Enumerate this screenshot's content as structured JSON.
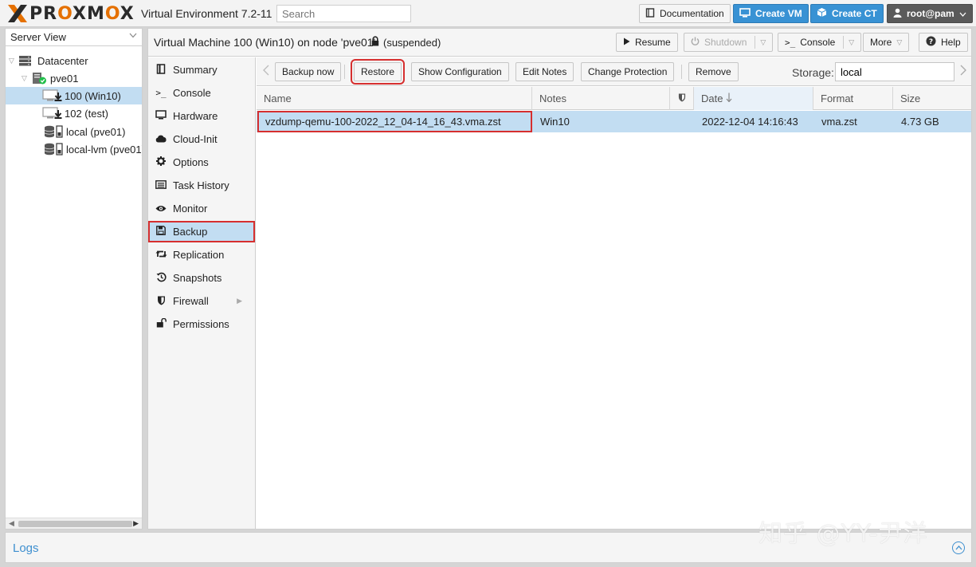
{
  "header": {
    "logo_prefix": "PR",
    "logo_o1": "O",
    "logo_mid": "XM",
    "logo_o2": "O",
    "logo_suffix": "X",
    "product": "Virtual Environment 7.2-11",
    "search_placeholder": "Search",
    "buttons": {
      "documentation": "Documentation",
      "create_vm": "Create VM",
      "create_ct": "Create CT",
      "user": "root@pam"
    }
  },
  "tree": {
    "view": "Server View",
    "items": [
      {
        "label": "Datacenter",
        "icon": "datacenter-icon"
      },
      {
        "label": "pve01",
        "icon": "node-online-icon"
      },
      {
        "label": "100 (Win10)",
        "icon": "vm-suspended-icon"
      },
      {
        "label": "102 (test)",
        "icon": "vm-suspended-icon"
      },
      {
        "label": "local (pve01)",
        "icon": "storage-icon"
      },
      {
        "label": "local-lvm (pve01)",
        "icon": "storage-icon"
      }
    ]
  },
  "vm_header": {
    "title": "Virtual Machine 100 (Win10) on node 'pve01'",
    "status": "(suspended)",
    "buttons": {
      "resume": "Resume",
      "shutdown": "Shutdown",
      "console": "Console",
      "more": "More",
      "help": "Help"
    }
  },
  "nav": [
    {
      "label": "Summary",
      "icon": "summary-icon"
    },
    {
      "label": "Console",
      "icon": "console-icon"
    },
    {
      "label": "Hardware",
      "icon": "hardware-icon"
    },
    {
      "label": "Cloud-Init",
      "icon": "cloud-icon"
    },
    {
      "label": "Options",
      "icon": "gear-icon"
    },
    {
      "label": "Task History",
      "icon": "list-icon"
    },
    {
      "label": "Monitor",
      "icon": "eye-icon"
    },
    {
      "label": "Backup",
      "icon": "floppy-icon"
    },
    {
      "label": "Replication",
      "icon": "retweet-icon"
    },
    {
      "label": "Snapshots",
      "icon": "history-icon"
    },
    {
      "label": "Firewall",
      "icon": "shield-icon"
    },
    {
      "label": "Permissions",
      "icon": "unlock-icon"
    }
  ],
  "toolbar": {
    "backup_now": "Backup now",
    "restore": "Restore",
    "show_config": "Show Configuration",
    "edit_notes": "Edit Notes",
    "change_protection": "Change Protection",
    "remove": "Remove",
    "storage_label": "Storage:",
    "storage_value": "local"
  },
  "grid": {
    "columns": {
      "name": "Name",
      "notes": "Notes",
      "date": "Date",
      "format": "Format",
      "size": "Size"
    },
    "rows": [
      {
        "name": "vzdump-qemu-100-2022_12_04-14_16_43.vma.zst",
        "notes": "Win10",
        "date": "2022-12-04 14:16:43",
        "format": "vma.zst",
        "size": "4.73 GB"
      }
    ]
  },
  "logs": {
    "title": "Logs"
  },
  "watermark": "知乎 @YY-尹洋"
}
